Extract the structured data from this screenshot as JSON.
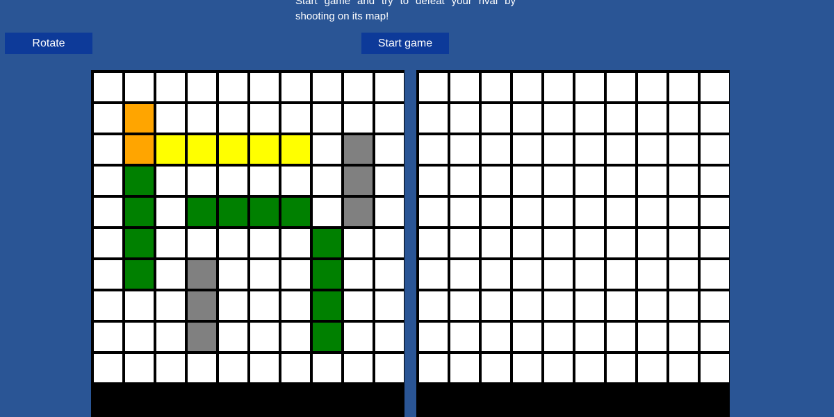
{
  "instructions": "Start game and try to defeat your rival by shooting on its map!",
  "buttons": {
    "rotate_label": "Rotate",
    "start_label": "Start game"
  },
  "colors": {
    "background": "#2a5595",
    "button": "#0d3a99",
    "grid_line": "#000000",
    "empty": "#ffffff",
    "ship_orange": "#ffa500",
    "ship_yellow": "#ffff00",
    "ship_green": "#008000",
    "ship_gray": "#808080"
  },
  "player_board": {
    "size": 10,
    "ships": [
      {
        "name": "orange-ship",
        "color": "ship_orange",
        "cells": [
          [
            1,
            1
          ],
          [
            2,
            1
          ]
        ]
      },
      {
        "name": "yellow-ship",
        "color": "ship_yellow",
        "cells": [
          [
            2,
            2
          ],
          [
            2,
            3
          ],
          [
            2,
            4
          ],
          [
            2,
            5
          ],
          [
            2,
            6
          ]
        ]
      },
      {
        "name": "gray-ship-right",
        "color": "ship_gray",
        "cells": [
          [
            2,
            8
          ],
          [
            3,
            8
          ],
          [
            4,
            8
          ]
        ]
      },
      {
        "name": "green-ship-left",
        "color": "ship_green",
        "cells": [
          [
            3,
            1
          ],
          [
            4,
            1
          ],
          [
            5,
            1
          ],
          [
            6,
            1
          ]
        ]
      },
      {
        "name": "green-ship-middle",
        "color": "ship_green",
        "cells": [
          [
            4,
            3
          ],
          [
            4,
            4
          ],
          [
            4,
            5
          ],
          [
            4,
            6
          ]
        ]
      },
      {
        "name": "green-ship-vertical",
        "color": "ship_green",
        "cells": [
          [
            5,
            7
          ],
          [
            6,
            7
          ],
          [
            7,
            7
          ],
          [
            8,
            7
          ]
        ]
      },
      {
        "name": "gray-ship-bottom",
        "color": "ship_gray",
        "cells": [
          [
            6,
            3
          ],
          [
            7,
            3
          ],
          [
            8,
            3
          ]
        ]
      }
    ]
  },
  "rival_board": {
    "size": 10,
    "ships": []
  }
}
